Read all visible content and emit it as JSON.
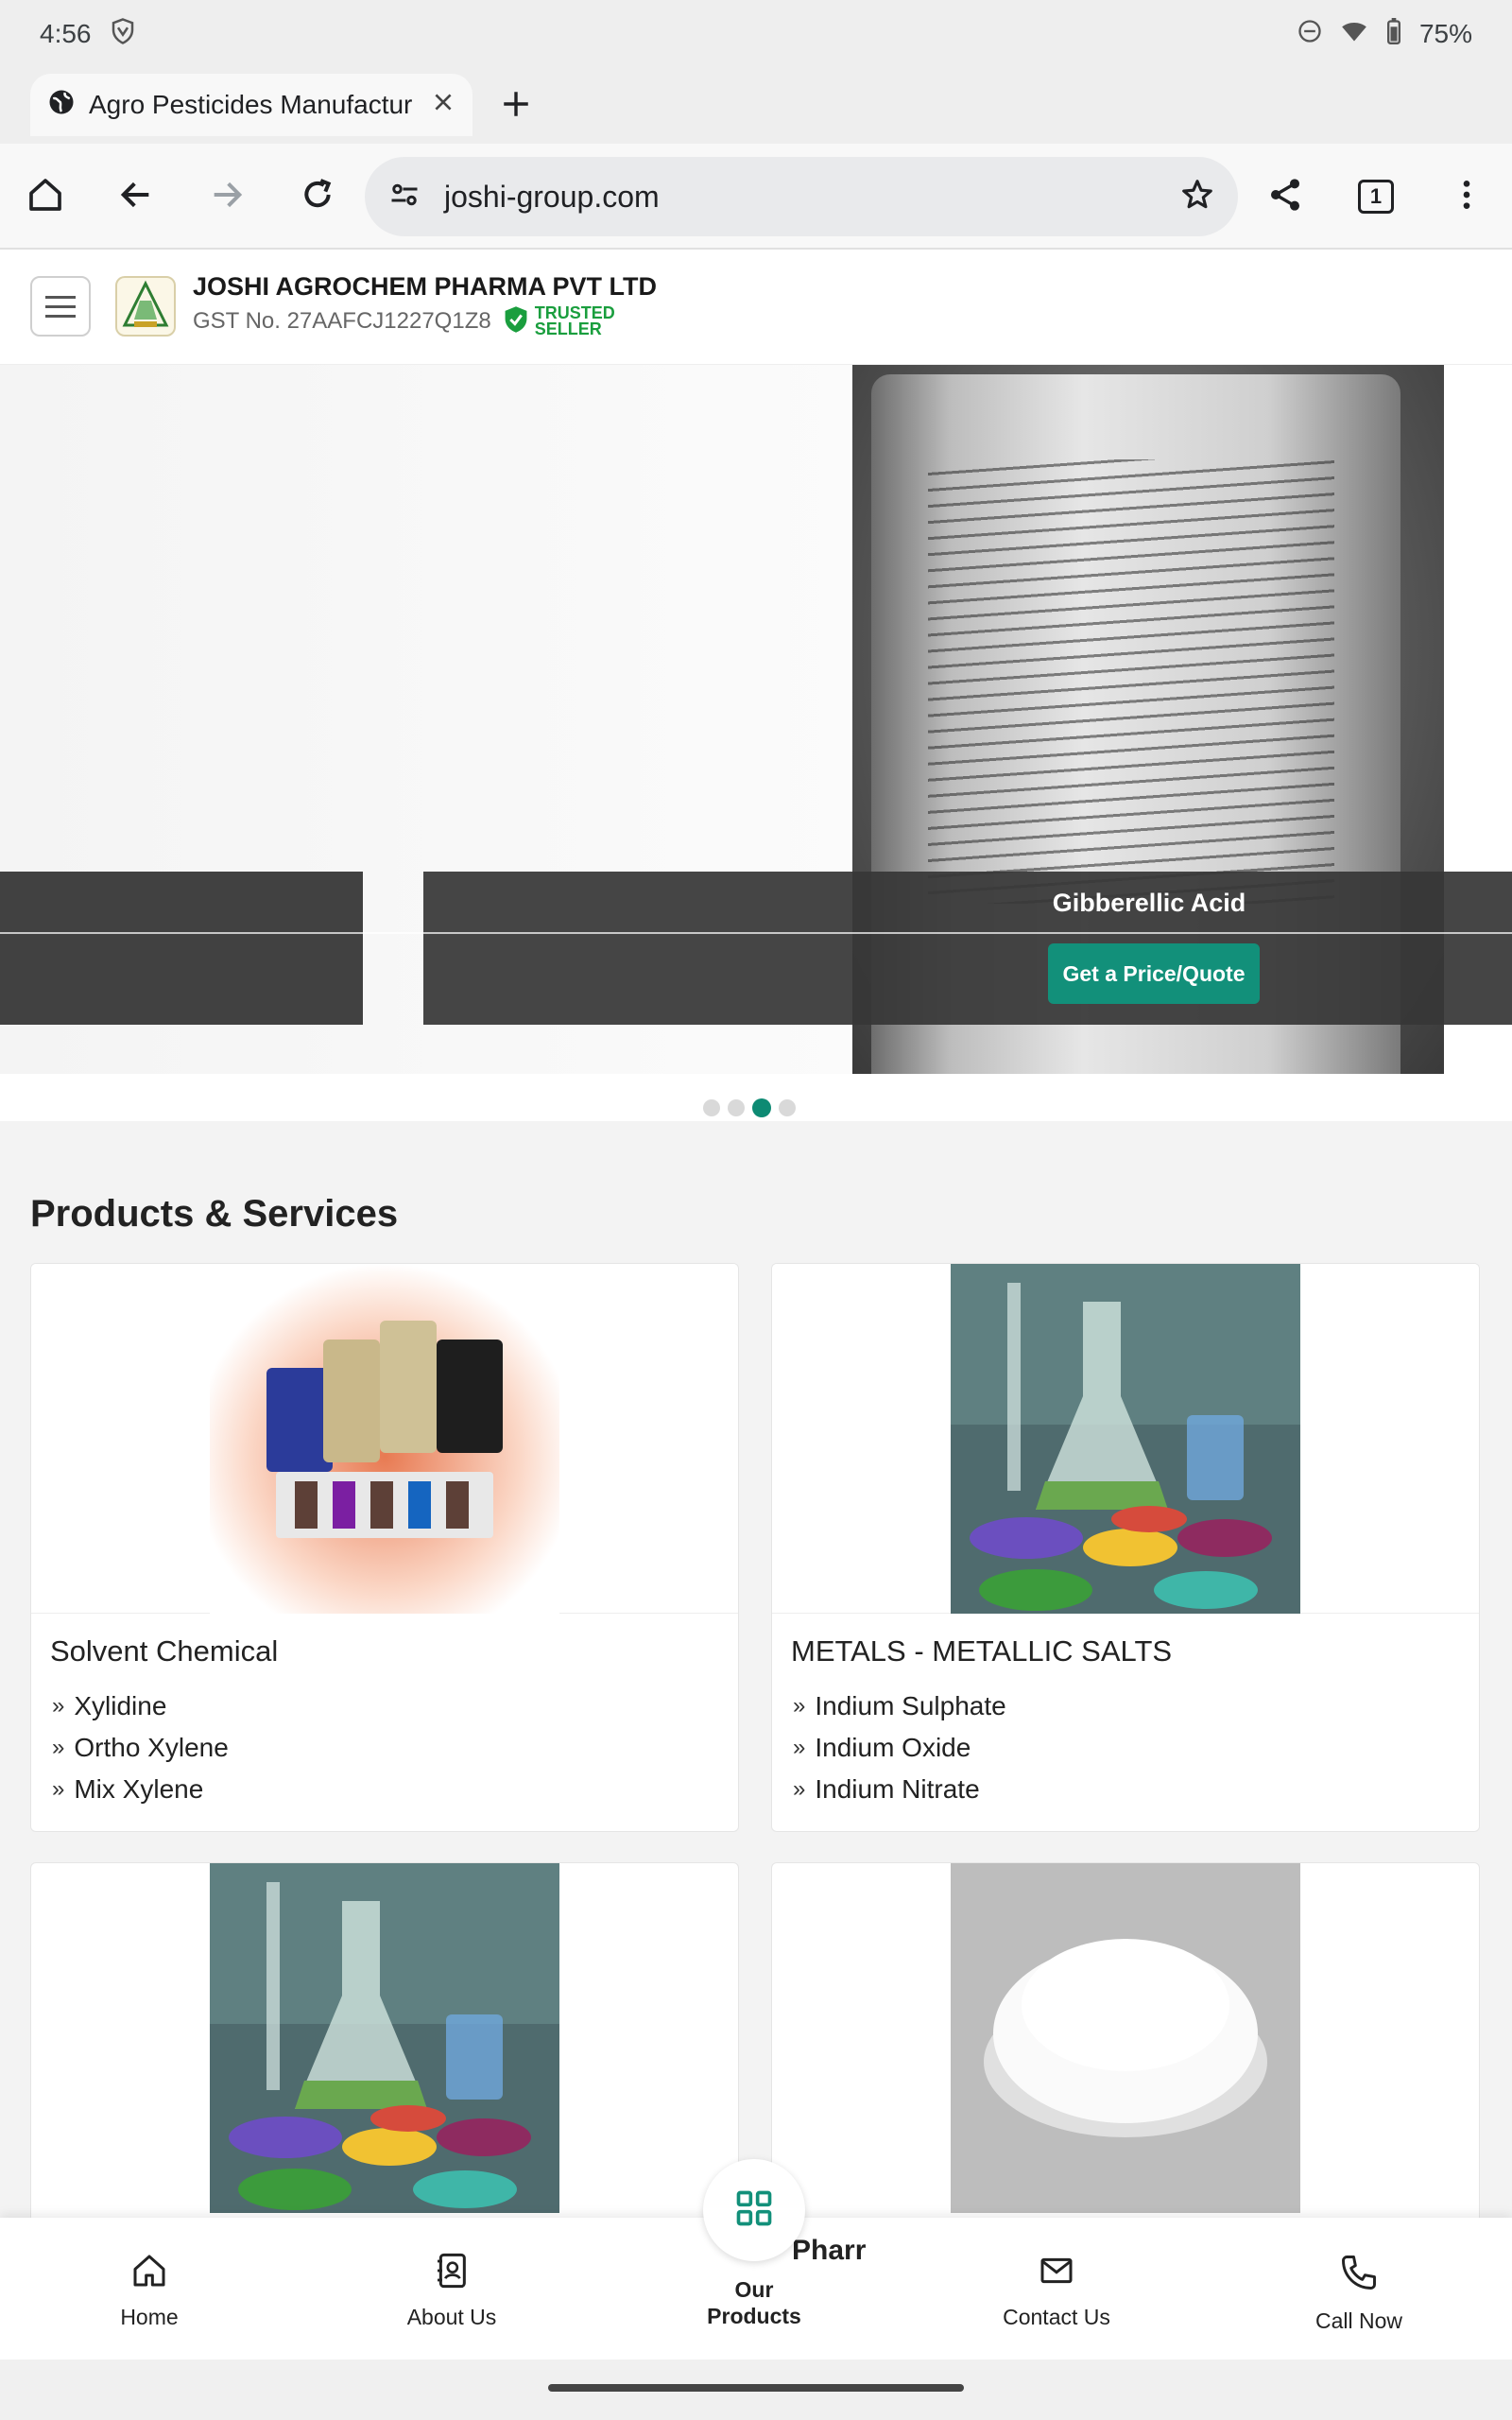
{
  "status_bar": {
    "time": "4:56",
    "battery": "75%"
  },
  "browser": {
    "tab_title": "Agro Pesticides Manufactur",
    "url": "joshi-group.com",
    "tab_count": "1"
  },
  "site": {
    "company_name": "JOSHI AGROCHEM PHARMA PVT LTD",
    "gst": "GST No. 27AAFCJ1227Q1Z8",
    "trusted_line1": "TRUSTED",
    "trusted_line2": "SELLER"
  },
  "hero": {
    "slide_caption": "Gibberellic Acid",
    "quote_button": "Get a Price/Quote",
    "slide_count": 4,
    "active_slide": 3
  },
  "products": {
    "section_title": "Products & Services",
    "cards": [
      {
        "title": "Solvent Chemical",
        "items": [
          "Xylidine",
          "Ortho Xylene",
          "Mix Xylene"
        ]
      },
      {
        "title": "METALS - METALLIC SALTS",
        "items": [
          "Indium Sulphate",
          "Indium Oxide",
          "Indium Nitrate"
        ]
      }
    ]
  },
  "bottom_nav": {
    "home": "Home",
    "about": "About Us",
    "products_line1": "Our",
    "products_line2": "Products",
    "contact": "Contact Us",
    "call": "Call Now",
    "peek_text": "Pharr"
  },
  "colors": {
    "brand_green": "#12907a",
    "trusted_green": "#1a9e3e"
  }
}
